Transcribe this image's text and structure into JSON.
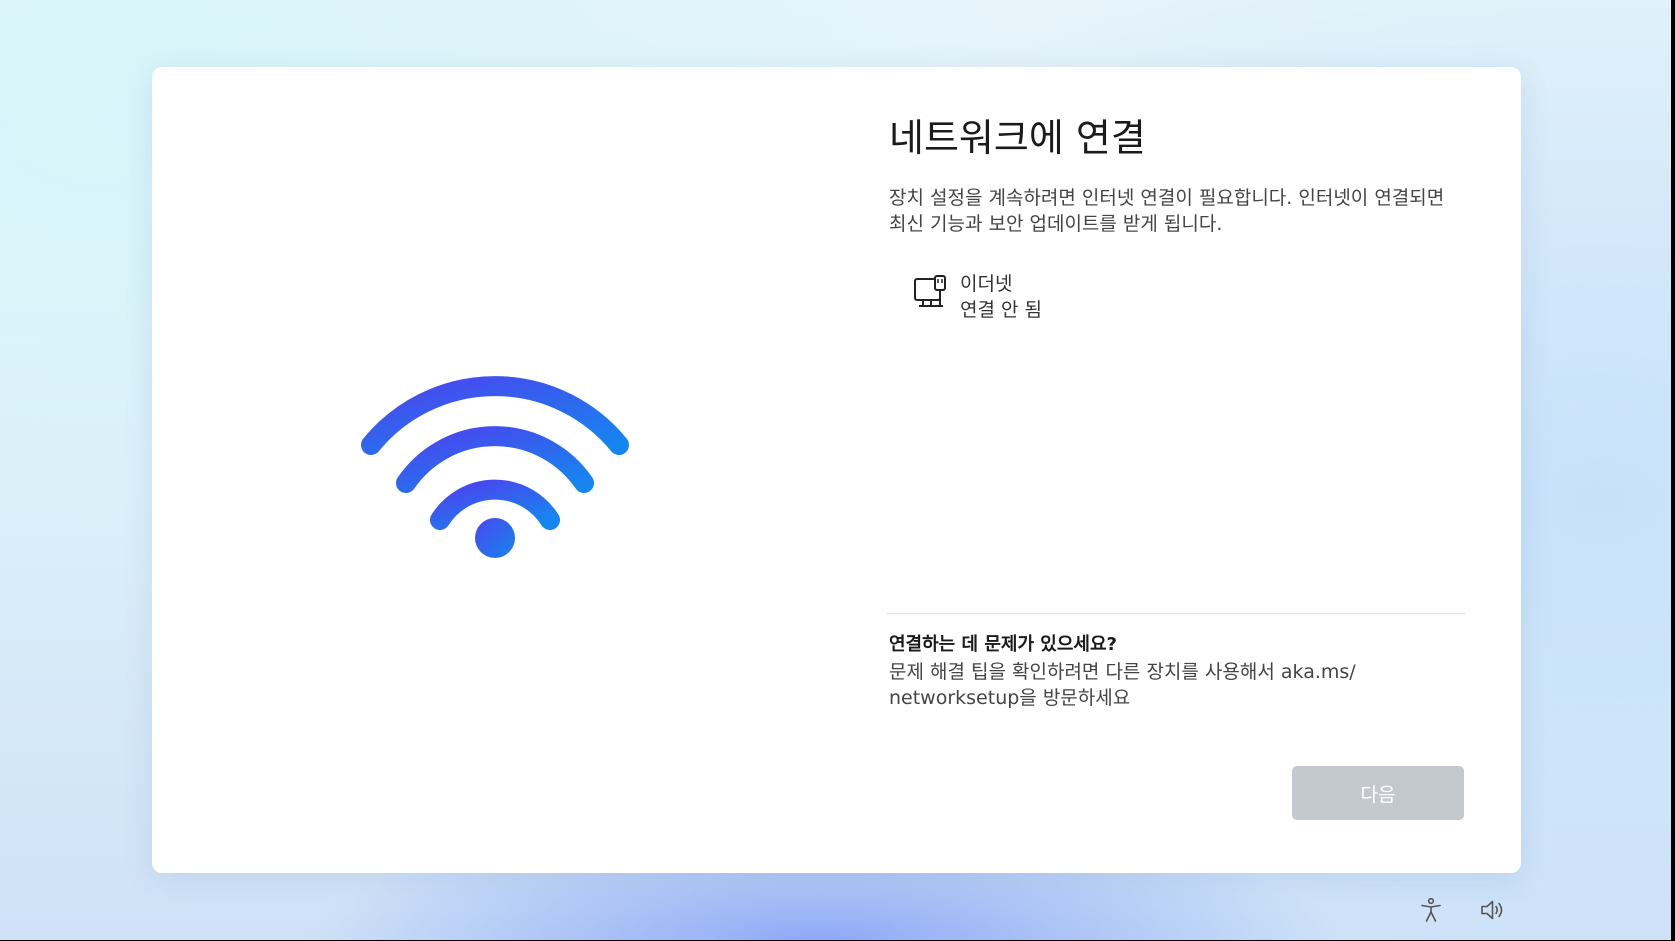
{
  "dialog": {
    "title": "네트워크에 연결",
    "description": "장치 설정을 계속하려면 인터넷 연결이 필요합니다. 인터넷이 연결되면 최신 기능과 보안 업데이트를 받게 됩니다.",
    "illustration_icon": "wifi-icon",
    "networks": [
      {
        "icon": "ethernet-icon",
        "name": "이더넷",
        "status": "연결 안 됨"
      }
    ],
    "help": {
      "title": "연결하는 데 문제가 있으세요?",
      "text": "문제 해결 팁을 확인하려면 다른 장치를 사용해서 aka.ms/ networksetup을 방문하세요"
    },
    "next_button_label": "다음"
  },
  "tray": {
    "icons": [
      "accessibility-icon",
      "volume-icon"
    ]
  },
  "colors": {
    "next_button_disabled": "#c4c9cf",
    "wifi_gradient_start": "#4a4af0",
    "wifi_gradient_end": "#1a7ef0"
  }
}
